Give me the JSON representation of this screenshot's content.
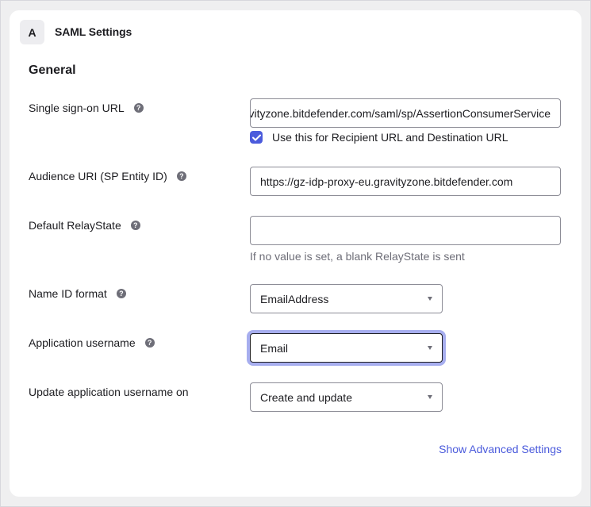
{
  "card": {
    "step_letter": "A",
    "title": "SAML Settings"
  },
  "section": {
    "title": "General"
  },
  "fields": {
    "sso_url": {
      "label": "Single sign-on URL",
      "value": "https://gz-idp-proxy-eu.gravityzone.bitdefender.com/saml/sp/AssertionConsumerService",
      "checkbox_label": "Use this for Recipient URL and Destination URL",
      "checkbox_checked": true
    },
    "audience_uri": {
      "label": "Audience URI (SP Entity ID)",
      "value": "https://gz-idp-proxy-eu.gravityzone.bitdefender.com"
    },
    "relay_state": {
      "label": "Default RelayState",
      "value": "",
      "hint": "If no value is set, a blank RelayState is sent"
    },
    "name_id_format": {
      "label": "Name ID format",
      "selected": "EmailAddress"
    },
    "app_username": {
      "label": "Application username",
      "selected": "Email"
    },
    "update_username": {
      "label": "Update application username on",
      "selected": "Create and update"
    }
  },
  "advanced_link": "Show Advanced Settings",
  "colors": {
    "accent": "#4b5bdc",
    "focus_ring": "#a7aeef",
    "background": "#efeff0"
  }
}
